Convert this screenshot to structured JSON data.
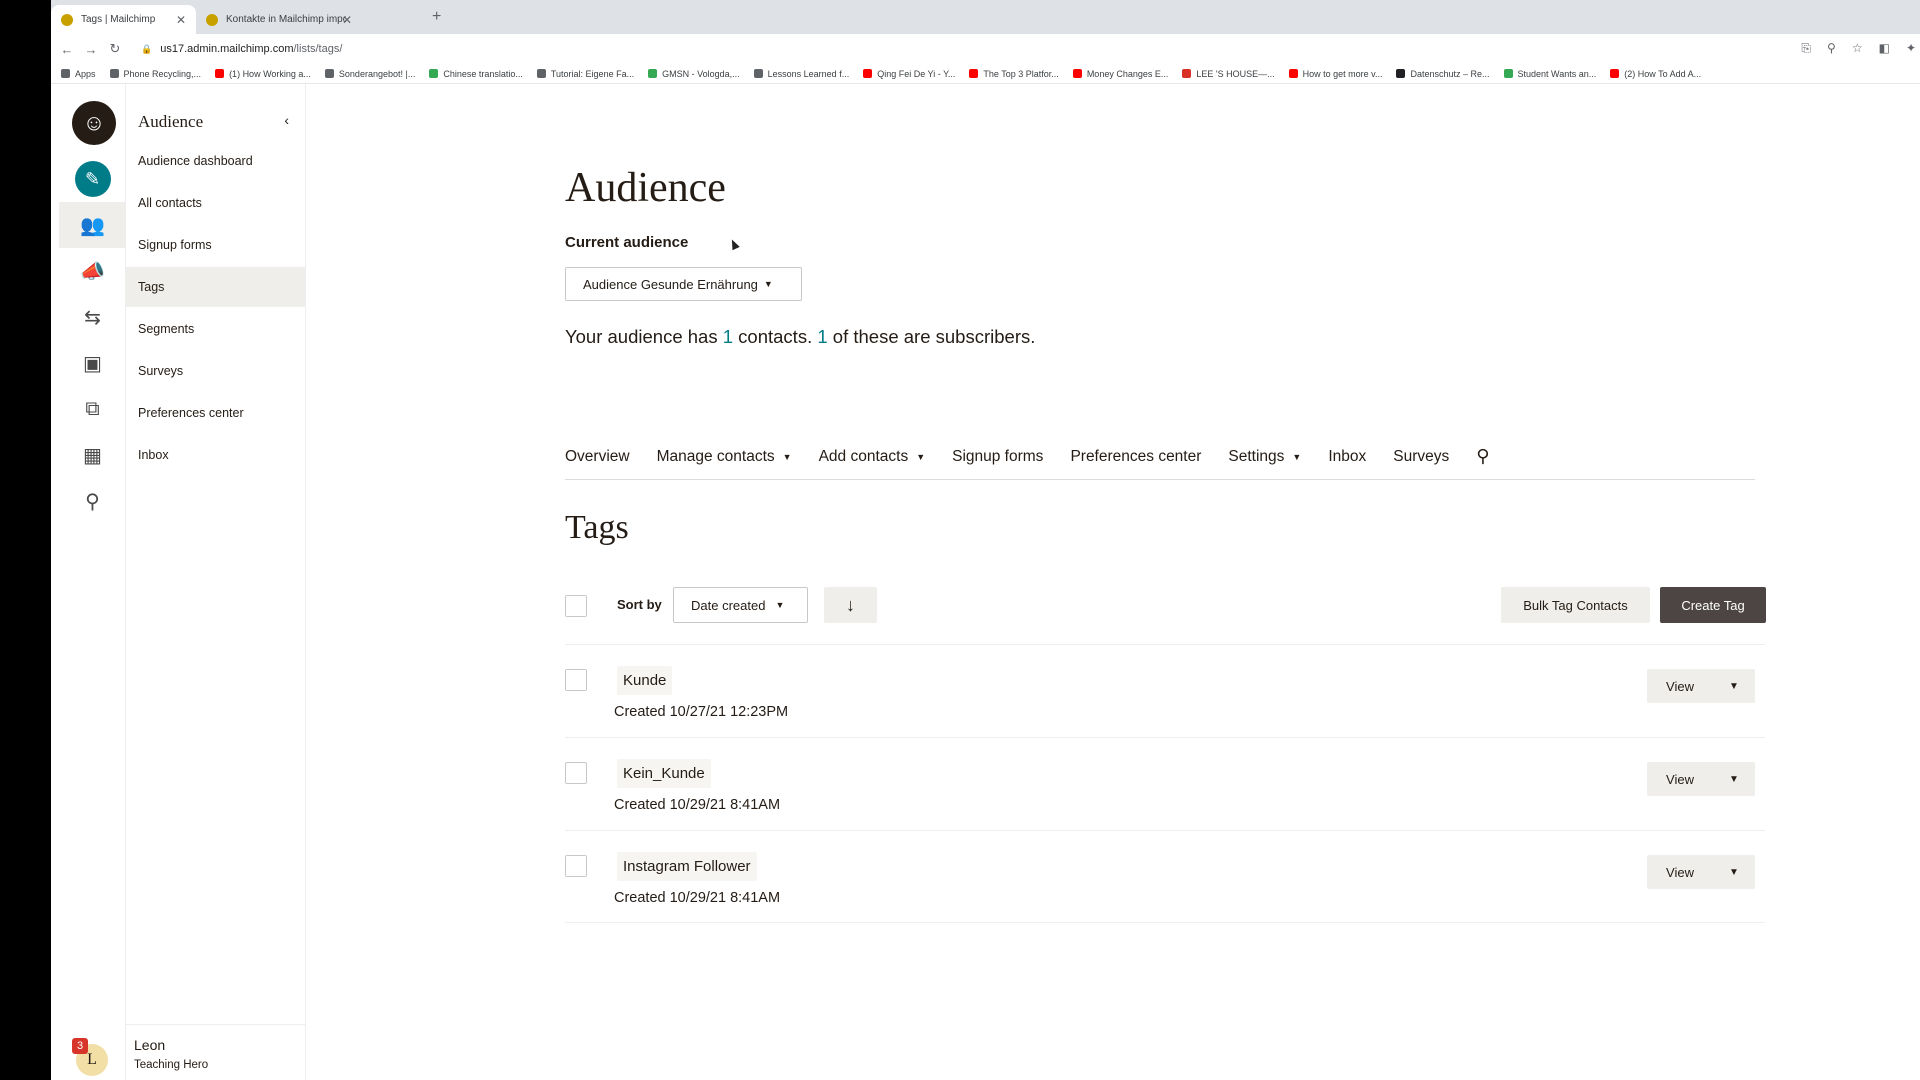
{
  "browser": {
    "tabs": [
      {
        "title": "Tags | Mailchimp",
        "active": true
      },
      {
        "title": "Kontakte in Mailchimp import",
        "active": false
      }
    ],
    "new_tab": "+",
    "url_host": "us17.admin.mailchimp.com",
    "url_path": "/lists/tags/",
    "bookmarks": [
      {
        "label": "Apps",
        "color": "#5f6368"
      },
      {
        "label": "Phone Recycling,...",
        "color": "#5f6368"
      },
      {
        "label": "(1) How Working a...",
        "color": "#ff0000"
      },
      {
        "label": "Sonderangebot! |...",
        "color": "#5f6368"
      },
      {
        "label": "Chinese translatio...",
        "color": "#34a853"
      },
      {
        "label": "Tutorial: Eigene Fa...",
        "color": "#5f6368"
      },
      {
        "label": "GMSN - Vologda,...",
        "color": "#34a853"
      },
      {
        "label": "Lessons Learned f...",
        "color": "#5f6368"
      },
      {
        "label": "Qing Fei De Yi - Y...",
        "color": "#ff0000"
      },
      {
        "label": "The Top 3 Platfor...",
        "color": "#ff0000"
      },
      {
        "label": "Money Changes E...",
        "color": "#ff0000"
      },
      {
        "label": "LEE 'S HOUSE—...",
        "color": "#d93025"
      },
      {
        "label": "How to get more v...",
        "color": "#ff0000"
      },
      {
        "label": "Datenschutz – Re...",
        "color": "#202124"
      },
      {
        "label": "Student Wants an...",
        "color": "#34a853"
      },
      {
        "label": "(2) How To Add A...",
        "color": "#ff0000"
      }
    ]
  },
  "rail": {
    "logo_icon": "mailchimp-freddie-icon",
    "items": [
      {
        "icon": "pencil-icon",
        "glyph": "✎",
        "name": "create"
      },
      {
        "icon": "audience-icon",
        "glyph": "👥",
        "name": "audience",
        "active": true
      },
      {
        "icon": "campaigns-megaphone-icon",
        "glyph": "📣",
        "name": "campaigns"
      },
      {
        "icon": "automations-icon",
        "glyph": "⇆",
        "name": "automations"
      },
      {
        "icon": "website-icon",
        "glyph": "▣",
        "name": "website"
      },
      {
        "icon": "content-studio-icon",
        "glyph": "⧉",
        "name": "content"
      },
      {
        "icon": "integrations-grid-icon",
        "glyph": "▦",
        "name": "integrations"
      },
      {
        "icon": "search-icon",
        "glyph": "⚲",
        "name": "search"
      }
    ],
    "notification_count": "3",
    "avatar_initial": "L"
  },
  "subnav": {
    "title": "Audience",
    "collapse_glyph": "‹",
    "items": [
      {
        "label": "Audience dashboard"
      },
      {
        "label": "All contacts"
      },
      {
        "label": "Signup forms"
      },
      {
        "label": "Tags",
        "active": true
      },
      {
        "label": "Segments"
      },
      {
        "label": "Surveys"
      },
      {
        "label": "Preferences center"
      },
      {
        "label": "Inbox"
      }
    ],
    "profile": {
      "name": "Leon",
      "role": "Teaching Hero"
    }
  },
  "main": {
    "page_title": "Audience",
    "current_audience_label": "Current audience",
    "audience_selected": "Audience Gesunde Ernährung",
    "summary": {
      "prefix": "Your audience has ",
      "contacts": "1",
      "middle": " contacts. ",
      "subscribers": "1",
      "suffix": " of these are subscribers."
    },
    "tabs": [
      {
        "label": "Overview",
        "dropdown": false
      },
      {
        "label": "Manage contacts",
        "dropdown": true
      },
      {
        "label": "Add contacts",
        "dropdown": true
      },
      {
        "label": "Signup forms",
        "dropdown": false
      },
      {
        "label": "Preferences center",
        "dropdown": false
      },
      {
        "label": "Settings",
        "dropdown": true
      },
      {
        "label": "Inbox",
        "dropdown": false
      },
      {
        "label": "Surveys",
        "dropdown": false
      }
    ],
    "section_title": "Tags",
    "sort_by_label": "Sort by",
    "sort_selected": "Date created",
    "sort_direction_glyph": "↓",
    "bulk_tag_label": "Bulk Tag Contacts",
    "create_tag_label": "Create Tag",
    "tags": [
      {
        "name": "Kunde",
        "created": "Created 10/27/21 12:23PM"
      },
      {
        "name": "Kein_Kunde",
        "created": "Created 10/29/21 8:41AM"
      },
      {
        "name": "Instagram Follower",
        "created": "Created 10/29/21 8:41AM"
      }
    ],
    "view_label": "View"
  },
  "colors": {
    "accent_teal": "#007c89",
    "brand_yellow": "#ffe01b",
    "primary_button": "#4d4543",
    "secondary_button": "#efeeea"
  }
}
